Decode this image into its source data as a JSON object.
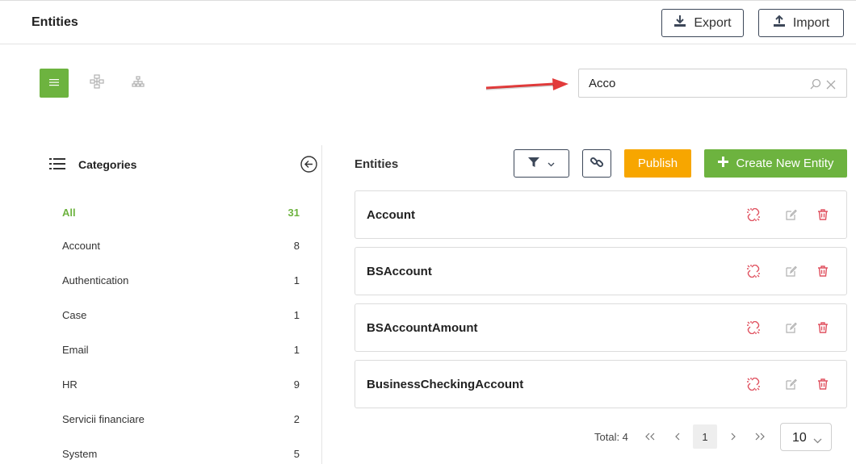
{
  "header": {
    "title": "Entities",
    "export_label": "Export",
    "import_label": "Import"
  },
  "search": {
    "value": "Acco",
    "placeholder": ""
  },
  "sidebar": {
    "title": "Categories",
    "items": [
      {
        "label": "All",
        "count": "31",
        "active": true
      },
      {
        "label": "Account",
        "count": "8"
      },
      {
        "label": "Authentication",
        "count": "1"
      },
      {
        "label": "Case",
        "count": "1"
      },
      {
        "label": "Email",
        "count": "1"
      },
      {
        "label": "HR",
        "count": "9"
      },
      {
        "label": "Servicii financiare",
        "count": "2"
      },
      {
        "label": "System",
        "count": "5"
      }
    ]
  },
  "main": {
    "title": "Entities",
    "publish_label": "Publish",
    "create_label": "Create New Entity",
    "entities": [
      {
        "name": "Account"
      },
      {
        "name": "BSAccount"
      },
      {
        "name": "BSAccountAmount"
      },
      {
        "name": "BusinessCheckingAccount"
      }
    ]
  },
  "pagination": {
    "total_text": "Total: 4",
    "current_page": "1",
    "page_size": "10"
  },
  "colors": {
    "accent_green": "#6db33f",
    "publish_orange": "#f7a600",
    "danger_red": "#e05260",
    "annotation_arrow": "#e23b3b"
  },
  "icons": {
    "export": "download-icon",
    "import": "upload-icon",
    "list_view": "list-icon",
    "graph_view": "graph-icon",
    "tree_view": "hierarchy-icon",
    "search": "search-icon",
    "clear": "close-icon",
    "categories": "list-icon",
    "collapse": "arrow-left-circle-icon",
    "filter": "filter-icon",
    "link": "link-icon",
    "create": "plus-icon",
    "unlink": "unlink-icon",
    "edit": "edit-icon",
    "delete": "trash-icon"
  }
}
